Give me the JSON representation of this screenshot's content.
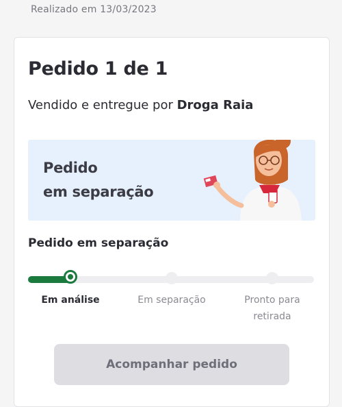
{
  "header": {
    "date_text": "Realizado em 13/03/2023"
  },
  "order": {
    "title": "Pedido 1 de 1",
    "seller_prefix": "Vendido e entregue por",
    "seller_name": "Droga Raia"
  },
  "banner": {
    "line1": "Pedido",
    "line2": "em separação",
    "illustration": "pharmacist-illustration",
    "background_color": "#e6f1fd"
  },
  "status": {
    "title": "Pedido em separação",
    "progress_fraction": 0.15,
    "steps": [
      {
        "label_line1": "Em análise",
        "label_line2": "",
        "state": "active"
      },
      {
        "label_line1": "Em separação",
        "label_line2": "",
        "state": "inactive"
      },
      {
        "label_line1": "Pronto para",
        "label_line2": "retirada",
        "state": "inactive"
      }
    ],
    "active_color": "#1b7a3e"
  },
  "actions": {
    "track_button_label": "Acompanhar pedido"
  }
}
